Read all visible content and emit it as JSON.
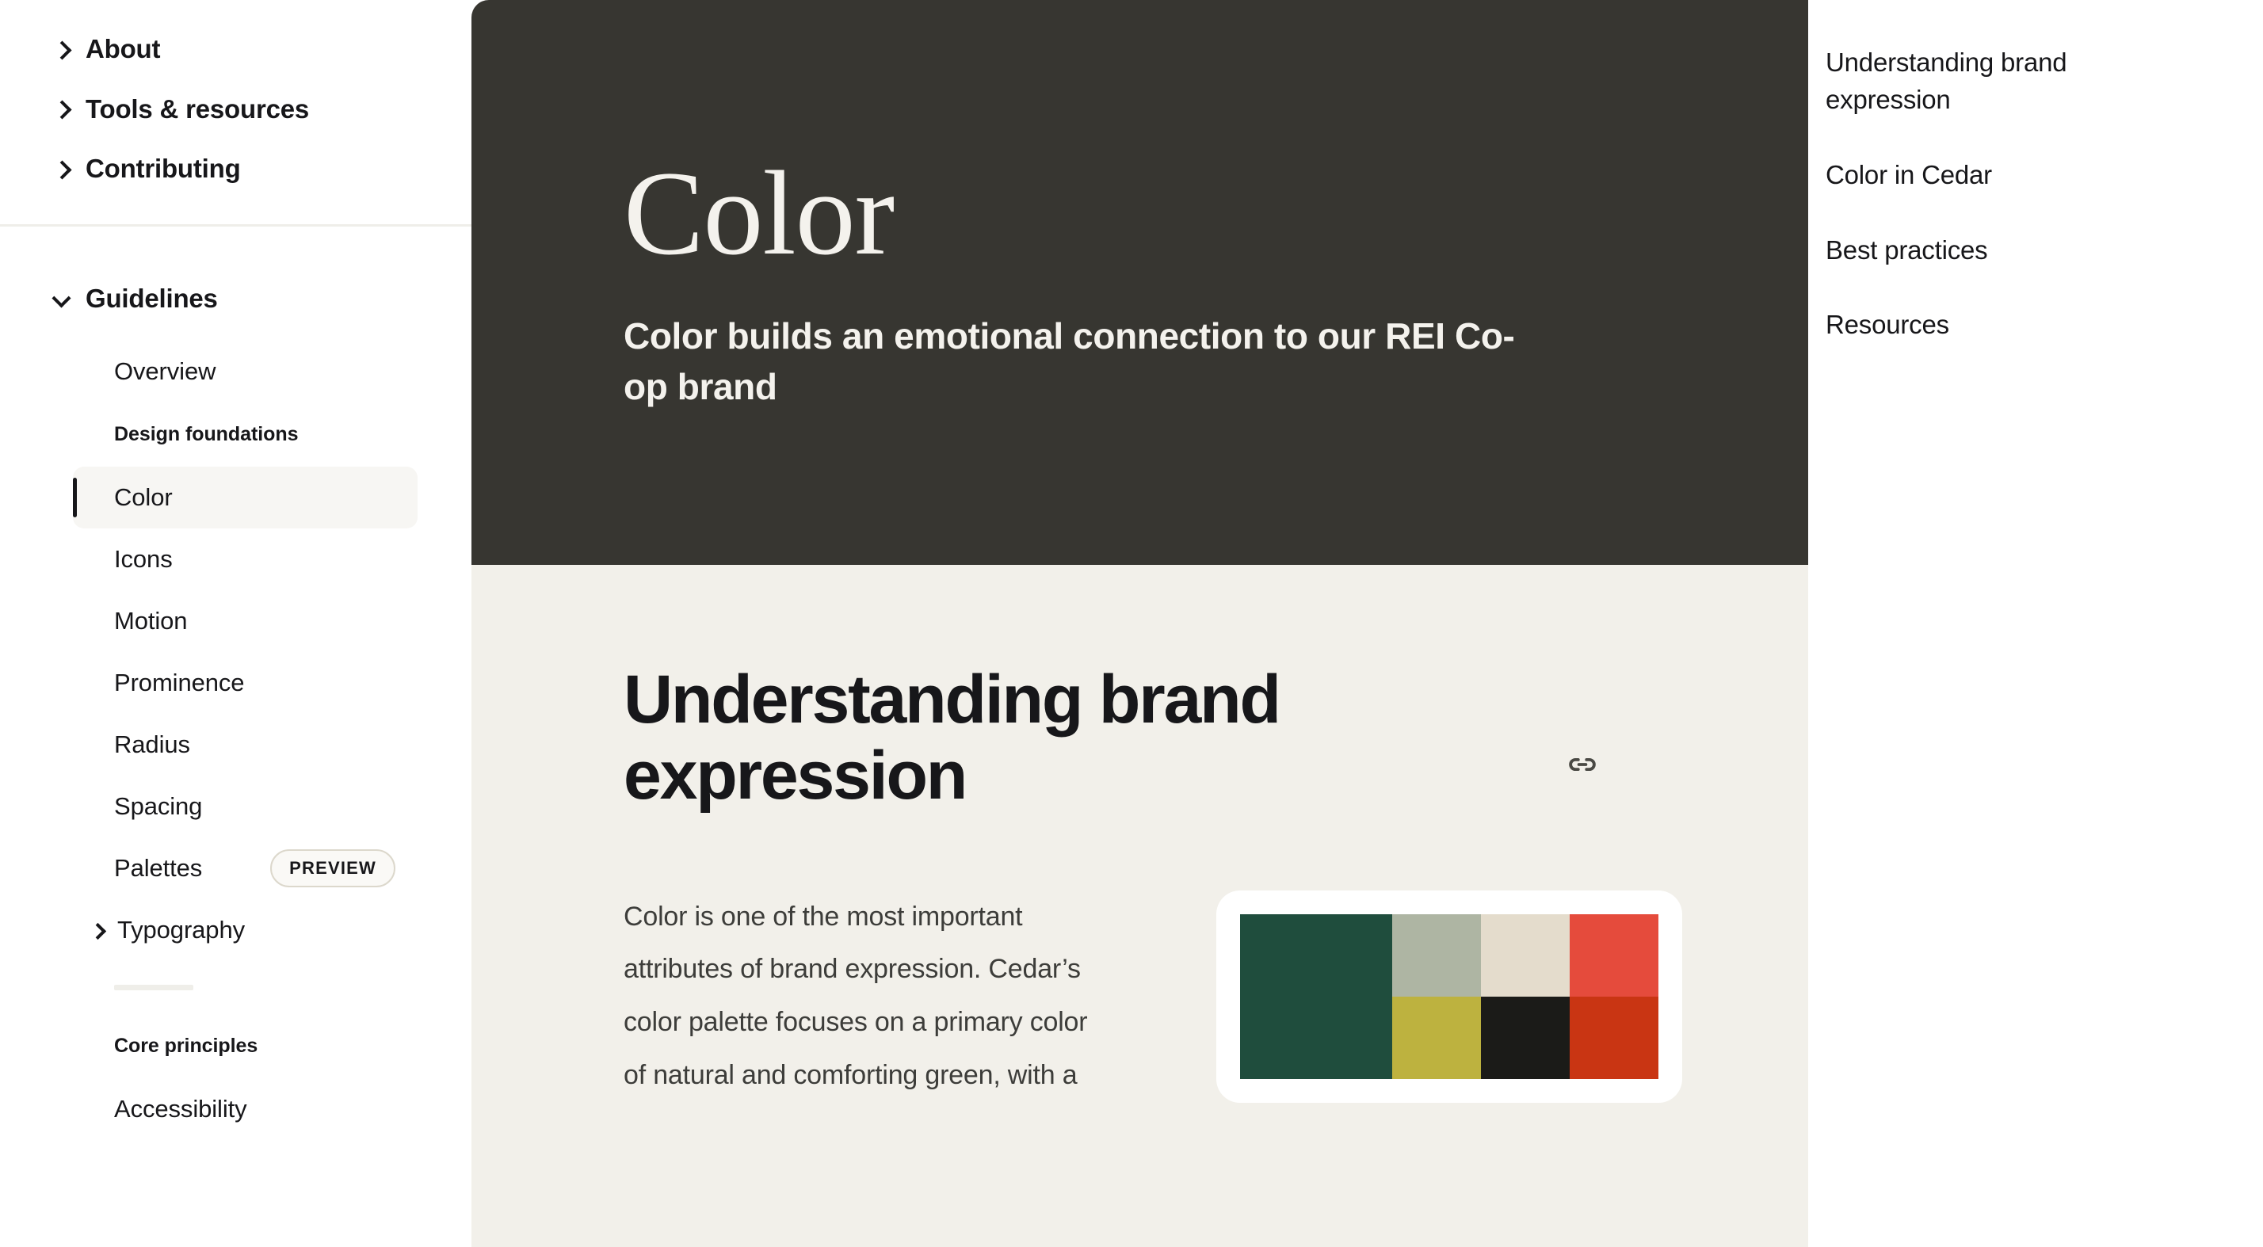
{
  "sidebar": {
    "top_nav": [
      {
        "label": "About",
        "icon": "chevron-right-icon",
        "expanded": false
      },
      {
        "label": "Tools & resources",
        "icon": "chevron-right-icon",
        "expanded": false
      },
      {
        "label": "Contributing",
        "icon": "chevron-right-icon",
        "expanded": false
      }
    ],
    "guidelines": {
      "label": "Guidelines",
      "icon": "chevron-down-icon",
      "expanded": true,
      "overview_label": "Overview",
      "design_foundations_label": "Design foundations",
      "foundations": [
        {
          "label": "Color",
          "active": true,
          "badge": ""
        },
        {
          "label": "Icons",
          "active": false,
          "badge": ""
        },
        {
          "label": "Motion",
          "active": false,
          "badge": ""
        },
        {
          "label": "Prominence",
          "active": false,
          "badge": ""
        },
        {
          "label": "Radius",
          "active": false,
          "badge": ""
        },
        {
          "label": "Spacing",
          "active": false,
          "badge": ""
        },
        {
          "label": "Palettes",
          "active": false,
          "badge": "PREVIEW"
        }
      ],
      "typography_label": "Typography",
      "core_principles_label": "Core principles",
      "accessibility_label": "Accessibility"
    }
  },
  "hero": {
    "title": "Color",
    "subtitle": "Color builds an emotional connection to our REI Co-op brand",
    "background_color": "#373631",
    "text_color": "#f4f2ed"
  },
  "main": {
    "section_heading": "Understanding brand expression",
    "anchor_icon": "link-icon",
    "body_text": "Color is one of the most important attributes of brand expression. Cedar’s color palette focuses on a primary color of natural and comforting green, with a",
    "background_color": "#f2f0ea"
  },
  "palette": {
    "card_background": "#ffffff",
    "swatches": [
      {
        "name": "primary-green",
        "color": "#1f4d3d",
        "span": 2
      },
      {
        "name": "sage",
        "color": "#aeb5a3",
        "span": 1
      },
      {
        "name": "cream",
        "color": "#e4dccc",
        "span": 1
      },
      {
        "name": "coral",
        "color": "#e54b3c",
        "span": 1
      },
      {
        "name": "olive-yellow",
        "color": "#bdb23f",
        "span": 1
      },
      {
        "name": "near-black",
        "color": "#1b1b18",
        "span": 1
      },
      {
        "name": "deep-red",
        "color": "#c93513",
        "span": 1
      }
    ]
  },
  "toc": {
    "items": [
      {
        "label": "Understanding brand expression"
      },
      {
        "label": "Color in Cedar"
      },
      {
        "label": "Best practices"
      },
      {
        "label": "Resources"
      }
    ]
  }
}
